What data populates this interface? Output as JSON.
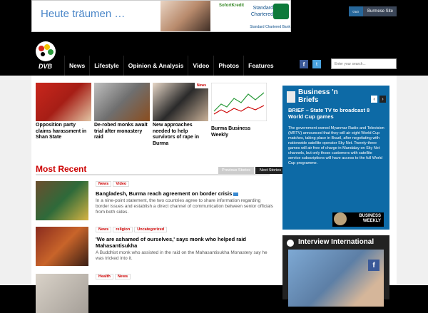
{
  "ad": {
    "headline": "Heute träumen …",
    "middle_text": "SofortKredit",
    "brand_name": "Standard Chartered",
    "brand_tagline": "Standard Chartered Bank"
  },
  "lang_switch": {
    "burmese_glyph": "ဗမာ",
    "label": "Burmese Site"
  },
  "logo": {
    "text": "DVB"
  },
  "nav": [
    "News",
    "Lifestyle",
    "Opinion & Analysis",
    "Video",
    "Photos",
    "Features"
  ],
  "social": {
    "facebook": "f",
    "twitter": "t"
  },
  "search": {
    "placeholder": "Enter your search..."
  },
  "features": [
    {
      "caption": "Opposition party claims harassment in Shan State",
      "tag": ""
    },
    {
      "caption": "De-robed monks await trial after monastery raid",
      "tag": ""
    },
    {
      "caption": "New approaches needed to help survivors of rape in Burma",
      "tag": "News"
    },
    {
      "caption": "Burma Business Weekly",
      "tag": ""
    }
  ],
  "most_recent": {
    "title": "Most Recent",
    "prev": "Previous Stories",
    "next": "Next Stories",
    "stories": [
      {
        "tags": [
          "News",
          "Video"
        ],
        "title": "Bangladesh, Burma reach agreement on border crisis",
        "summary": "In a nine-point statement, the two countries agree to share information regarding border issues and establish a direct channel of communication between senior officials from both sides."
      },
      {
        "tags": [
          "News",
          "religion",
          "Uncategorized"
        ],
        "title": "'We are ashamed of ourselves,' says monk who helped raid Mahasantisukha",
        "summary": "A Buddhist monk who assisted in the raid on the Mahasantisukha Monastery say he was tricked into it."
      },
      {
        "tags": [
          "Health",
          "News"
        ],
        "title": "",
        "summary": ""
      }
    ]
  },
  "business_briefs": {
    "title_line1": "Business 'n",
    "title_line2": "Briefs",
    "headline": "BRIEF – State TV to broadcast 8 World Cup games",
    "body": "The government-owned Myanmar Radio and Television (MRTV) announced that they will air eight World Cup matches, taking place in Brazil, after negotiating with nationwide satellite operator Sky Net. Twenty-three games will air free of charge in Mandalay on Sky Net channels, but only those customers with satellite service subscriptions will have access to the full World Cup programme.",
    "badge_line1": "BUSINESS",
    "badge_line2": "WEEKLY",
    "prev_arrow": "‹",
    "next_arrow": "›"
  },
  "interview": {
    "title": "Interview International",
    "fb_glyph": "f"
  },
  "colors": {
    "accent": "#cc0000",
    "sidebar_blue": "#0d6aa6",
    "nav_bg": "#000000"
  }
}
